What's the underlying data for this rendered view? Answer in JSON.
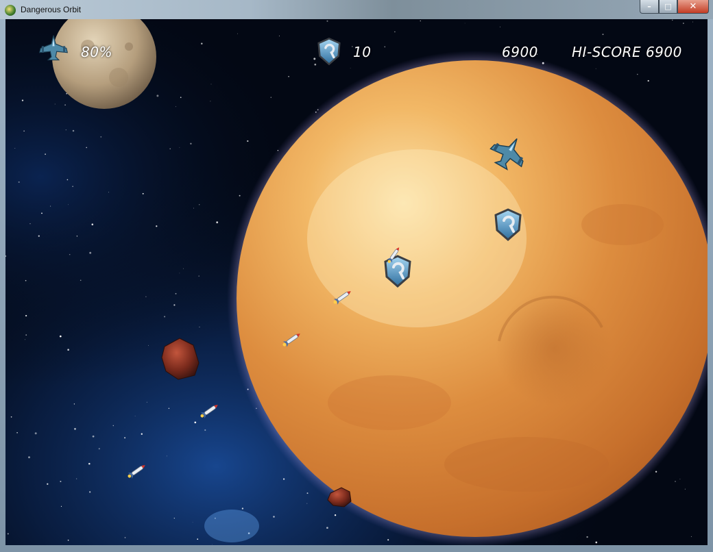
{
  "window": {
    "title": "Dangerous Orbit",
    "min_symbol": "–",
    "max_symbol": "□",
    "close_symbol": "✕"
  },
  "hud": {
    "ship_health": "80%",
    "shield_count": "10",
    "score": "6900",
    "hi_score": "HI-SCORE 6900"
  },
  "colors": {
    "planet_base": "#d98a3b",
    "planet_highlight": "#f6d79a",
    "shield_blue": "#4fa4d8",
    "ship_teal": "#4e8aa8",
    "hud_text": "#ffffff"
  }
}
